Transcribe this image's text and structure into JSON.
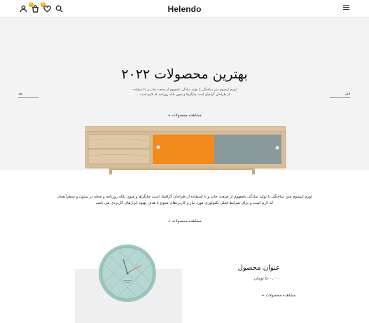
{
  "header": {
    "logo": "Helendo",
    "icons": [
      "user-icon",
      "cart-icon",
      "wishlist-icon",
      "search-icon",
      "menu-icon"
    ],
    "cart_count": "0",
    "wishlist_count": "0"
  },
  "hero": {
    "title": "بهترین محصولات ۲۰۲۲",
    "description": "لورم ایپسوم متن ساختگی با تولید سادگی نامفهوم از صنعت چاپ و با استفاده از طراحان گرافیک است چاپگرها و متون بلکه روزنامه که لازم است",
    "cta": "مشاهده محصولات +",
    "prev_label": "بعد",
    "next_label": "قبل"
  },
  "about": {
    "text": "لورم ایپسوم متن ساختگی با تولید سادگی نامفهوم از صنعت چاپ و با استفاده از طراحان گرافیک است چاپگرها و متون بلکه روزنامه و مجله در ستون و سطرآنچنان که لازم است و برای شرایط فعلی تکنولوژی مورد نیاز و کاربردهای متنوع با هدف بهبود ابزارهای کاربردی می باشد",
    "cta": "مشاهده محصولات +"
  },
  "product": {
    "title": "عنوان محصول",
    "price": "۵۰۰,۰۰۰ تومان",
    "cta": "مشاهده محصولات +"
  },
  "colors": {
    "hero_bg": "#f3f3f3",
    "wood": "#d8bf9c",
    "orange": "#f28a1c",
    "gray_panel": "#8a9a9a",
    "clock_face": "#a8cfc8",
    "badge": "#f2a900"
  }
}
